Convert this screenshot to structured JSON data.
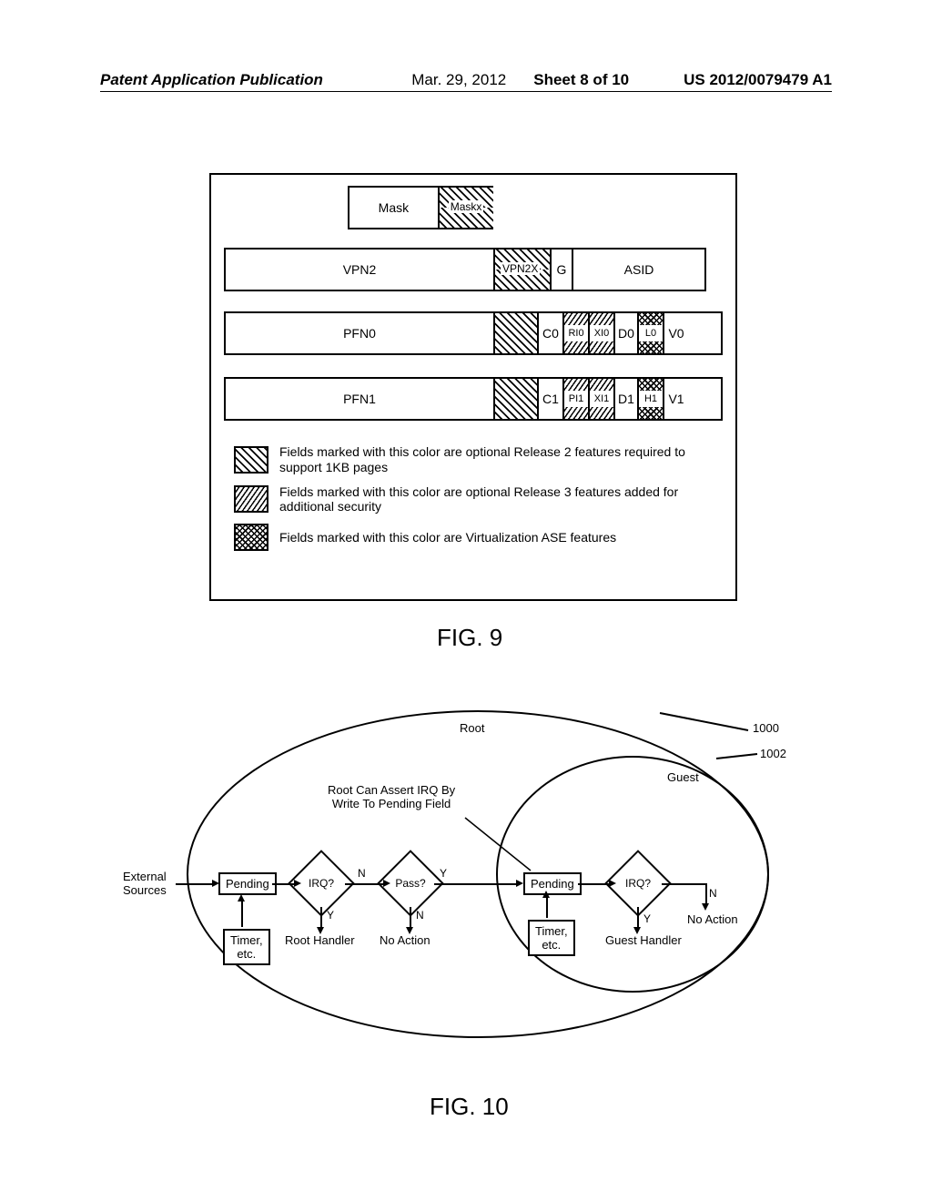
{
  "header": {
    "left": "Patent Application Publication",
    "date": "Mar. 29, 2012",
    "sheet": "Sheet 8 of 10",
    "pubno": "US 2012/0079479 A1"
  },
  "fig9": {
    "row0": {
      "mask": "Mask",
      "maskx": "Maskx"
    },
    "row1": {
      "vpn2": "VPN2",
      "vpn2x": "VPN2X",
      "g": "G",
      "asid": "ASID"
    },
    "row2": {
      "pfn0": "PFN0",
      "c0": "C0",
      "ri0": "RI0",
      "xi0": "XI0",
      "d0": "D0",
      "l0": "L0",
      "v0": "V0"
    },
    "row3": {
      "pfn1": "PFN1",
      "c1": "C1",
      "pi1": "PI1",
      "xi1": "XI1",
      "d1": "D1",
      "h1": "H1",
      "v1": "V1"
    },
    "legend1": "Fields marked with this color are optional Release 2 features required to support 1KB pages",
    "legend2": "Fields marked with this color are optional Release 3 features added for additional security",
    "legend3": "Fields marked with this color are Virtualization ASE features",
    "caption": "FIG. 9"
  },
  "fig10": {
    "root": "Root",
    "guest": "Guest",
    "external_sources": "External\nSources",
    "pending": "Pending",
    "timer": "Timer,\netc.",
    "irq": "IRQ?",
    "pass": "Pass?",
    "root_handler": "Root Handler",
    "no_action": "No Action",
    "guest_handler": "Guest Handler",
    "assert_text": "Root Can Assert IRQ By\nWrite To Pending Field",
    "y": "Y",
    "n": "N",
    "ref_1000": "1000",
    "ref_1002": "1002",
    "caption": "FIG. 10"
  }
}
